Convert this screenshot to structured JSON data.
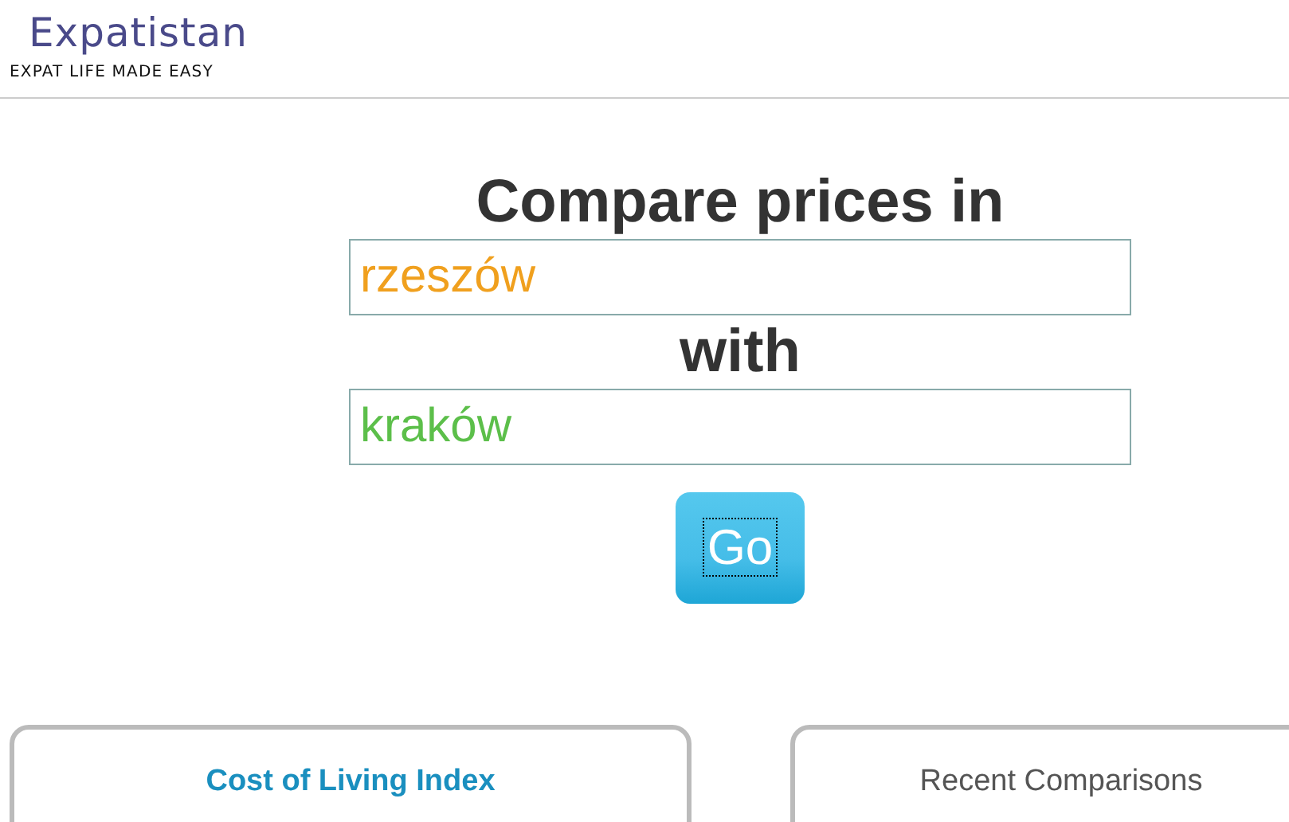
{
  "logo": {
    "name": "Expatistan",
    "tagline": "EXPAT LIFE MADE EASY"
  },
  "compare": {
    "title": "Compare prices in",
    "joiner": "with",
    "button": "Go",
    "fields": [
      {
        "value": "rzeszów",
        "color": "#f0a01e"
      },
      {
        "value": "kraków",
        "color": "#5cbf4a"
      }
    ]
  },
  "panels": [
    {
      "title": "Cost of Living Index",
      "kind": "link"
    },
    {
      "title": "Recent Comparisons",
      "kind": "plain"
    }
  ]
}
